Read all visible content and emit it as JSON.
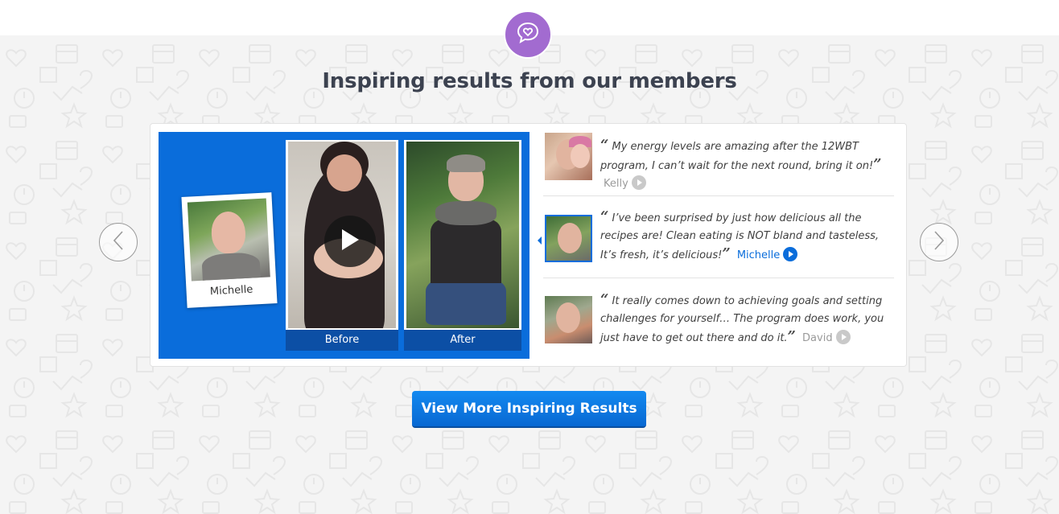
{
  "section": {
    "icon": "heart-speech-bubble-icon",
    "heading": "Inspiring results from our members",
    "accent_color": "#a26bd0"
  },
  "video": {
    "polaroid_name": "Michelle",
    "before_label": "Before",
    "after_label": "After",
    "play_icon": "play-icon",
    "panel_color": "#0a6ddb"
  },
  "testimonials": [
    {
      "quote": "My energy levels are amazing after the 12WBT program, I can’t wait for the next round, bring it on!",
      "author": "Kelly",
      "active": false
    },
    {
      "quote": "I’ve been surprised by just how delicious all the recipes are! Clean eating is NOT bland and tasteless, It’s fresh, it’s delicious!",
      "author": "Michelle",
      "active": true
    },
    {
      "quote": "It really comes down to achieving goals and setting challenges for yourself… The program does work, you just have to get out there and do it.",
      "author": "David",
      "active": false
    }
  ],
  "quote_marks": {
    "open": "“",
    "close": "”"
  },
  "navigation": {
    "prev_icon": "chevron-left-icon",
    "next_icon": "chevron-right-icon"
  },
  "cta": {
    "label": "View More Inspiring Results",
    "color": "#0a6ddb"
  }
}
